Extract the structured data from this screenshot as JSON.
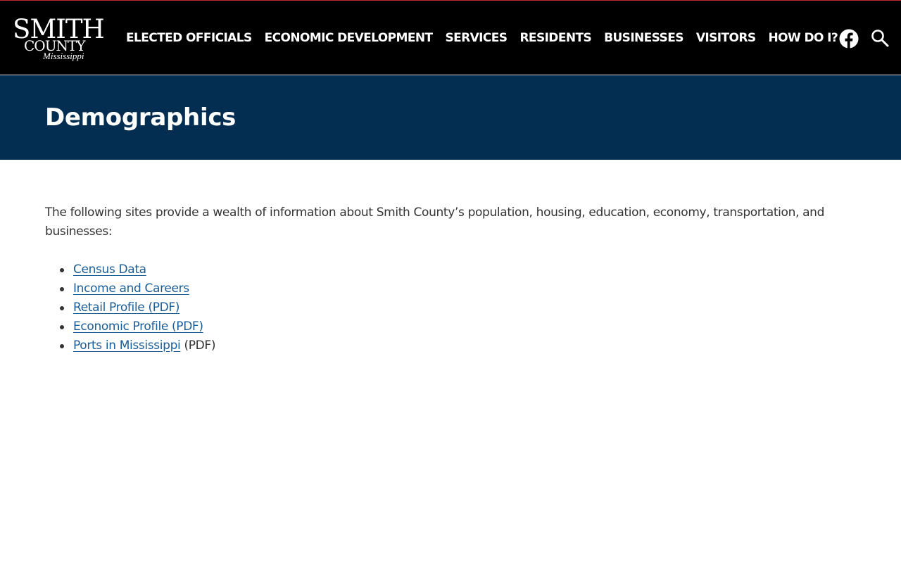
{
  "header": {
    "logo": {
      "line1": "SMITH",
      "line2": "COUNTY",
      "line3": "Mississippi"
    },
    "nav": [
      {
        "label": "ELECTED OFFICIALS"
      },
      {
        "label": "ECONOMIC DEVELOPMENT"
      },
      {
        "label": "SERVICES"
      },
      {
        "label": "RESIDENTS"
      },
      {
        "label": "BUSINESSES"
      },
      {
        "label": "VISITORS"
      },
      {
        "label": "HOW DO I?"
      }
    ],
    "icons": {
      "facebook": "facebook-icon",
      "search": "search-icon"
    }
  },
  "page": {
    "title": "Demographics",
    "intro": "The following sites provide a wealth of information about Smith County’s population, housing, education, economy, transportation, and businesses:",
    "links": [
      {
        "label": "Census Data",
        "suffix": ""
      },
      {
        "label": "Income and Careers",
        "suffix": ""
      },
      {
        "label": "Retail Profile (PDF)",
        "suffix": ""
      },
      {
        "label": "Economic Profile (PDF)",
        "suffix": ""
      },
      {
        "label": "Ports in Mississippi",
        "suffix": "(PDF)"
      }
    ]
  },
  "colors": {
    "header_bg": "#000000",
    "header_top_border": "#c0262d",
    "hero_bg": "#032e52",
    "link": "#1b5d96",
    "body_text": "#333333"
  }
}
